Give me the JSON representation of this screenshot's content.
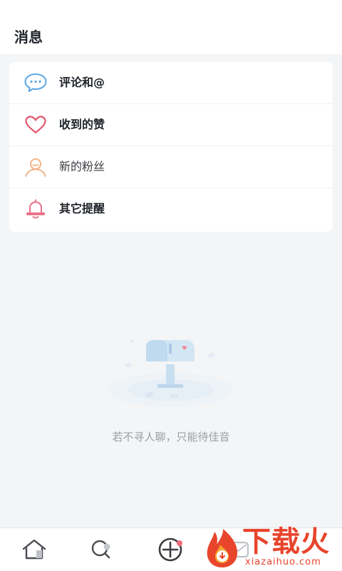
{
  "header": {
    "title": "消息"
  },
  "message_categories": [
    {
      "label": "评论和@",
      "icon": "comment-bubble-icon"
    },
    {
      "label": "收到的赞",
      "icon": "heart-icon"
    },
    {
      "label": "新的粉丝",
      "icon": "person-icon"
    },
    {
      "label": "其它提醒",
      "icon": "bell-icon"
    }
  ],
  "empty_state": {
    "illustration": "mailbox-illustration",
    "text": "若不寻人聊，只能待佳音"
  },
  "tabbar": {
    "items": [
      {
        "icon": "home-icon"
      },
      {
        "icon": "search-icon"
      },
      {
        "icon": "add-icon"
      },
      {
        "icon": "message-icon"
      }
    ]
  },
  "watermark": {
    "title": "下载火",
    "subtitle": "xiazaihuo.com"
  },
  "colors": {
    "page_background": "#f4f5f7",
    "card_background": "#ffffff",
    "comment_icon": "#5aa6e6",
    "heart_icon": "#e0566b",
    "person_icon": "#f2b38a",
    "bell_icon": "#e9728a",
    "watermark": "#e8452c"
  }
}
